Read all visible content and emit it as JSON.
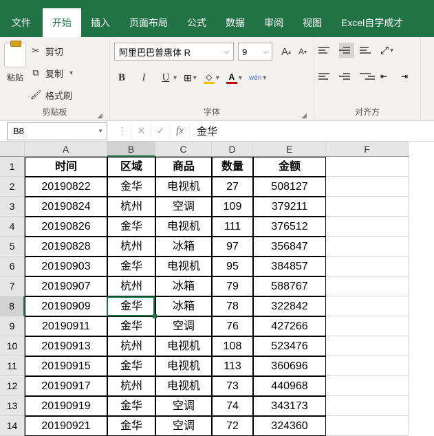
{
  "tabs": {
    "file": "文件",
    "home": "开始",
    "insert": "插入",
    "layout": "页面布局",
    "formula": "公式",
    "data": "数据",
    "review": "审阅",
    "view": "视图",
    "excel_self": "Excel自学成才"
  },
  "ribbon": {
    "paste": "粘贴",
    "cut": "剪切",
    "copy": "复制",
    "format_painter": "格式刷",
    "group_clipboard": "剪贴板",
    "group_font": "字体",
    "group_align": "对齐方",
    "font_name": "阿里巴巴普惠体 R",
    "font_size": "9",
    "wen": "wén"
  },
  "formula_bar": {
    "cell_ref": "B8",
    "value": "金华"
  },
  "columns": [
    "A",
    "B",
    "C",
    "D",
    "E",
    "F"
  ],
  "headers": [
    "时间",
    "区域",
    "商品",
    "数量",
    "金额"
  ],
  "rows": [
    [
      "20190822",
      "金华",
      "电视机",
      "27",
      "508127"
    ],
    [
      "20190824",
      "杭州",
      "空调",
      "109",
      "379211"
    ],
    [
      "20190826",
      "金华",
      "电视机",
      "111",
      "376512"
    ],
    [
      "20190828",
      "杭州",
      "冰箱",
      "97",
      "356847"
    ],
    [
      "20190903",
      "金华",
      "电视机",
      "95",
      "384857"
    ],
    [
      "20190907",
      "杭州",
      "冰箱",
      "79",
      "588767"
    ],
    [
      "20190909",
      "金华",
      "冰箱",
      "78",
      "322842"
    ],
    [
      "20190911",
      "金华",
      "空调",
      "76",
      "427266"
    ],
    [
      "20190913",
      "杭州",
      "电视机",
      "108",
      "523476"
    ],
    [
      "20190915",
      "金华",
      "电视机",
      "113",
      "360696"
    ],
    [
      "20190917",
      "杭州",
      "电视机",
      "73",
      "440968"
    ],
    [
      "20190919",
      "金华",
      "空调",
      "74",
      "343173"
    ],
    [
      "20190921",
      "金华",
      "空调",
      "72",
      "324360"
    ]
  ]
}
